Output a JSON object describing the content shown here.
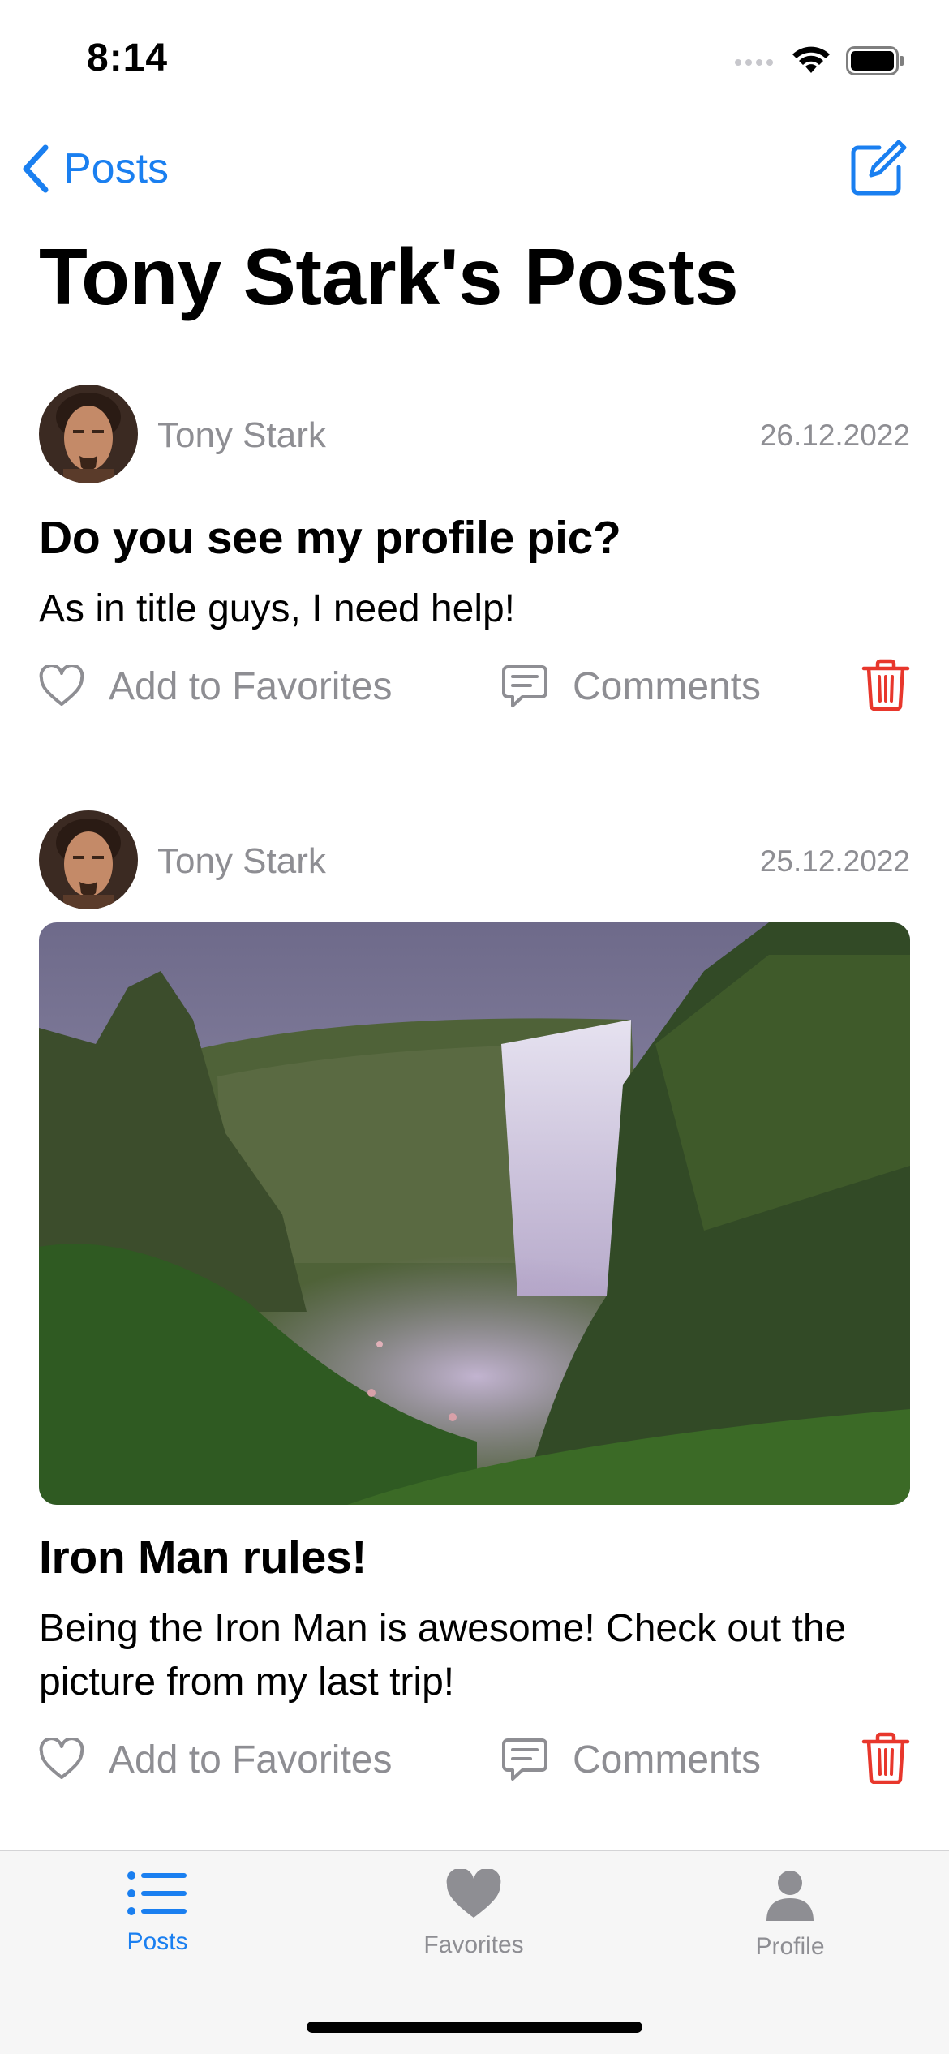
{
  "status_bar": {
    "time": "8:14"
  },
  "nav": {
    "back_label": "Posts",
    "title": "Tony Stark's Posts"
  },
  "posts": [
    {
      "author": "Tony Stark",
      "date": "26.12.2022",
      "title": "Do you see my profile pic?",
      "body": "As in title guys, I need help!",
      "favorite_label": "Add to Favorites",
      "comments_label": "Comments",
      "has_image": false
    },
    {
      "author": "Tony Stark",
      "date": "25.12.2022",
      "title": "Iron Man rules!",
      "body": "Being the Iron Man is awesome! Check out the picture from my last trip!",
      "favorite_label": "Add to Favorites",
      "comments_label": "Comments",
      "has_image": true
    }
  ],
  "tabbar": {
    "items": [
      {
        "label": "Posts",
        "icon": "list-icon",
        "selected": true
      },
      {
        "label": "Favorites",
        "icon": "heart-filled-icon",
        "selected": false
      },
      {
        "label": "Profile",
        "icon": "person-icon",
        "selected": false
      }
    ]
  },
  "colors": {
    "accent": "#1a7ff0",
    "secondary_text": "#8e8e93",
    "destructive": "#e8372c",
    "tab_inactive": "#8e8e93"
  }
}
